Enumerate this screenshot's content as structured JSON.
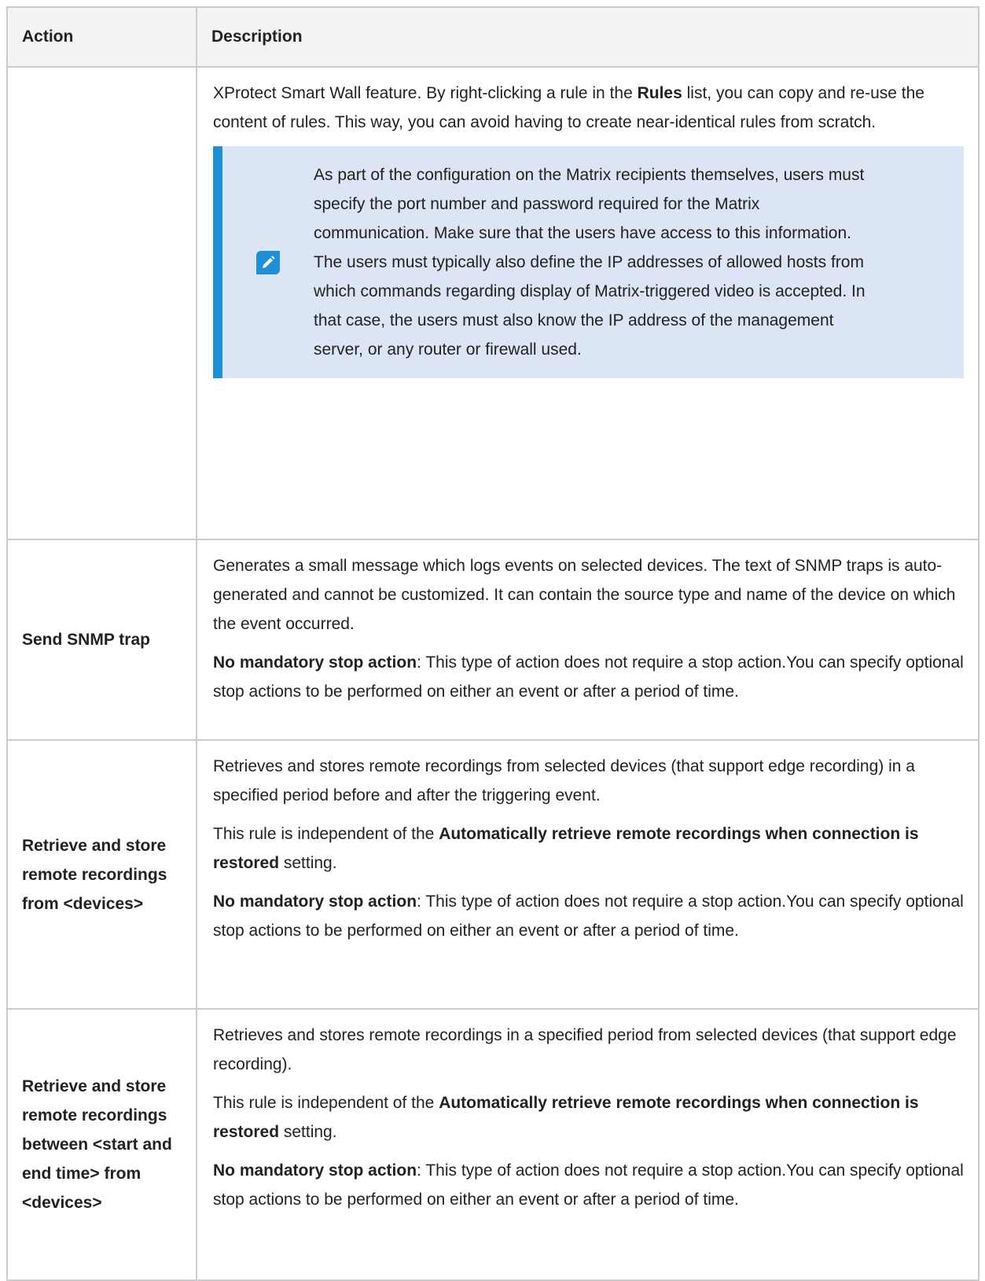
{
  "table": {
    "headers": [
      "Action",
      "Description"
    ],
    "rows": [
      {
        "action": "",
        "paragraphs": [
          {
            "parts": [
              {
                "text": "XProtect Smart Wall feature. By right-clicking a rule in the ",
                "bold": false
              },
              {
                "text": "Rules",
                "bold": true
              },
              {
                "text": " list, you can copy and re-use the content of rules. This way, you can avoid having to create near-identical rules from scratch.",
                "bold": false
              }
            ]
          }
        ],
        "note": {
          "icon": "pencil-edit-icon",
          "text": "As part of the configuration on the Matrix recipients themselves, users must specify the port number and password required for the Matrix communication. Make sure that the users have access to this information. The users must typically also define the IP addresses of allowed hosts from which commands regarding display of Matrix-triggered video is accepted. In that case, the users must also know the IP address of the management server, or any router or firewall used."
        }
      },
      {
        "action": "Send SNMP trap",
        "paragraphs": [
          {
            "parts": [
              {
                "text": "Generates a small message which logs events on selected devices. The text of SNMP traps is auto-generated and cannot be customized. It can contain the source type and name of the device on which the event occurred.",
                "bold": false
              }
            ]
          },
          {
            "parts": [
              {
                "text": "No mandatory stop action",
                "bold": true
              },
              {
                "text": ": This type of action does not require a stop action.You can specify optional stop actions to be performed on either an event or after a period of time.",
                "bold": false
              }
            ]
          }
        ]
      },
      {
        "action": "Retrieve and store remote recordings from <devices>",
        "paragraphs": [
          {
            "parts": [
              {
                "text": "Retrieves and stores remote recordings from selected devices (that support edge recording) in a specified period before and after the triggering event.",
                "bold": false
              }
            ]
          },
          {
            "parts": [
              {
                "text": "This rule is independent of the ",
                "bold": false
              },
              {
                "text": "Automatically retrieve remote recordings when connection is restored",
                "bold": true
              },
              {
                "text": " setting.",
                "bold": false
              }
            ]
          },
          {
            "parts": [
              {
                "text": "No mandatory stop action",
                "bold": true
              },
              {
                "text": ": This type of action does not require a stop action.You can specify optional stop actions to be performed on either an event or after a period of time.",
                "bold": false
              }
            ]
          }
        ]
      },
      {
        "action": "Retrieve and store remote recordings between <start and end time> from <devices>",
        "paragraphs": [
          {
            "parts": [
              {
                "text": "Retrieves and stores remote recordings in a specified period from selected devices (that support edge recording).",
                "bold": false
              }
            ]
          },
          {
            "parts": [
              {
                "text": "This rule is independent of the ",
                "bold": false
              },
              {
                "text": "Automatically retrieve remote recordings when connection is restored",
                "bold": true
              },
              {
                "text": " setting.",
                "bold": false
              }
            ]
          },
          {
            "parts": [
              {
                "text": "No mandatory stop action",
                "bold": true
              },
              {
                "text": ": This type of action does not require a stop action.You can specify optional stop actions to be performed on either an event or after a period of time.",
                "bold": false
              }
            ]
          }
        ]
      }
    ]
  }
}
